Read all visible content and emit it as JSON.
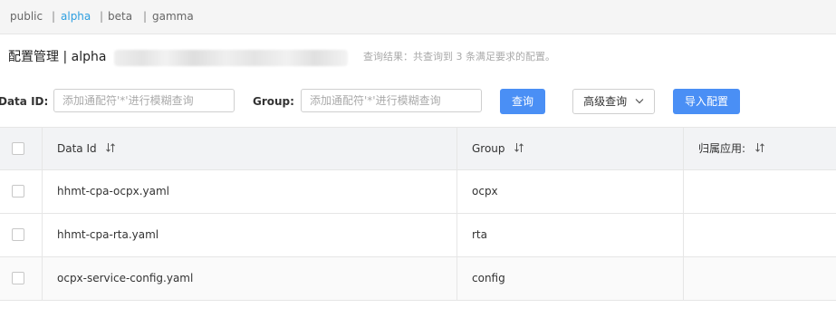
{
  "namespaces": {
    "items": [
      {
        "label": "public"
      },
      {
        "label": "alpha"
      },
      {
        "label": "beta"
      },
      {
        "label": "gamma"
      }
    ],
    "separator": "|",
    "active_index": 1,
    "active_color": "#2e9fe0"
  },
  "header": {
    "title": "配置管理 | alpha",
    "result_text": "查询结果：共查询到 3 条满足要求的配置。"
  },
  "search": {
    "data_id_label": "Data ID:",
    "data_id_placeholder": "添加通配符'*'进行模糊查询",
    "group_label": "Group:",
    "group_placeholder": "添加通配符'*'进行模糊查询",
    "query_button": "查询",
    "advanced_button": "高级查询",
    "import_button": "导入配置"
  },
  "table": {
    "columns": [
      {
        "label": "Data Id",
        "icon": "sort-icon"
      },
      {
        "label": "Group",
        "icon": "sort-icon"
      },
      {
        "label": "归属应用:",
        "icon": "sort-icon"
      }
    ],
    "rows": [
      {
        "data_id": "hhmt-cpa-ocpx.yaml",
        "group": "ocpx",
        "app": ""
      },
      {
        "data_id": "hhmt-cpa-rta.yaml",
        "group": "rta",
        "app": ""
      },
      {
        "data_id": "ocpx-service-config.yaml",
        "group": "config",
        "app": ""
      }
    ]
  },
  "colors": {
    "primary_button": "#4a8ff5",
    "header_bg": "#f2f3f5"
  }
}
